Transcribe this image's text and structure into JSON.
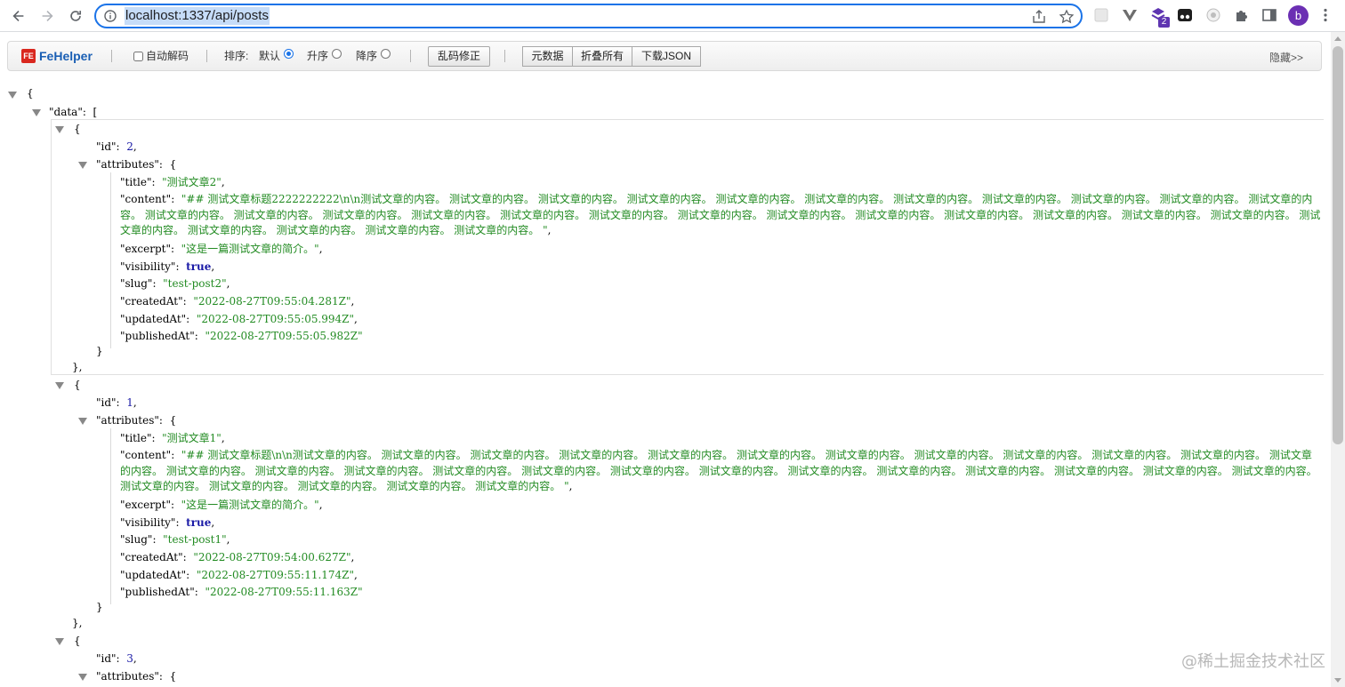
{
  "browser": {
    "url": "localhost:1337/api/posts",
    "profile_initial": "b",
    "extension_badge": "2"
  },
  "fehelper": {
    "brand": "FeHelper",
    "logo_mark": "FE",
    "auto_decode_label": "自动解码",
    "sort_label": "排序:",
    "sort_default": "默认",
    "sort_asc": "升序",
    "sort_desc": "降序",
    "fix_garbled_button": "乱码修正",
    "raw_button": "元数据",
    "collapse_all_button": "折叠所有",
    "download_button": "下载JSON",
    "hide_label": "隐藏>>"
  },
  "json": {
    "open_brace": "{",
    "data_key": "\"data\":",
    "open_bracket": "[",
    "posts": [
      {
        "id_key": "\"id\":",
        "id": "2",
        "attributes_key": "\"attributes\":",
        "title_key": "\"title\":",
        "title": "\"测试文章2\"",
        "content_key": "\"content\":",
        "content": "\"## 测试文章标题2222222222\\n\\n测试文章的内容。 测试文章的内容。 测试文章的内容。 测试文章的内容。 测试文章的内容。 测试文章的内容。 测试文章的内容。 测试文章的内容。 测试文章的内容。 测试文章的内容。 测试文章的内容。 测试文章的内容。 测试文章的内容。 测试文章的内容。 测试文章的内容。 测试文章的内容。 测试文章的内容。 测试文章的内容。 测试文章的内容。 测试文章的内容。 测试文章的内容。 测试文章的内容。 测试文章的内容。 测试文章的内容。 测试文章的内容。 测试文章的内容。 测试文章的内容。 测试文章的内容。 测试文章的内容。 \"",
        "excerpt_key": "\"excerpt\":",
        "excerpt": "\"这是一篇测试文章的简介。\"",
        "visibility_key": "\"visibility\":",
        "visibility": "true",
        "slug_key": "\"slug\":",
        "slug": "\"test-post2\"",
        "createdAt_key": "\"createdAt\":",
        "createdAt": "\"2022-08-27T09:55:04.281Z\"",
        "updatedAt_key": "\"updatedAt\":",
        "updatedAt": "\"2022-08-27T09:55:05.994Z\"",
        "publishedAt_key": "\"publishedAt\":",
        "publishedAt": "\"2022-08-27T09:55:05.982Z\""
      },
      {
        "id_key": "\"id\":",
        "id": "1",
        "attributes_key": "\"attributes\":",
        "title_key": "\"title\":",
        "title": "\"测试文章1\"",
        "content_key": "\"content\":",
        "content": "\"## 测试文章标题\\n\\n测试文章的内容。 测试文章的内容。 测试文章的内容。 测试文章的内容。 测试文章的内容。 测试文章的内容。 测试文章的内容。 测试文章的内容。 测试文章的内容。 测试文章的内容。 测试文章的内容。 测试文章的内容。 测试文章的内容。 测试文章的内容。 测试文章的内容。 测试文章的内容。 测试文章的内容。 测试文章的内容。 测试文章的内容。 测试文章的内容。 测试文章的内容。 测试文章的内容。 测试文章的内容。 测试文章的内容。 测试文章的内容。 测试文章的内容。 测试文章的内容。 测试文章的内容。 测试文章的内容。 测试文章的内容。 \"",
        "excerpt_key": "\"excerpt\":",
        "excerpt": "\"这是一篇测试文章的简介。\"",
        "visibility_key": "\"visibility\":",
        "visibility": "true",
        "slug_key": "\"slug\":",
        "slug": "\"test-post1\"",
        "createdAt_key": "\"createdAt\":",
        "createdAt": "\"2022-08-27T09:54:00.627Z\"",
        "updatedAt_key": "\"updatedAt\":",
        "updatedAt": "\"2022-08-27T09:55:11.174Z\"",
        "publishedAt_key": "\"publishedAt\":",
        "publishedAt": "\"2022-08-27T09:55:11.163Z\""
      },
      {
        "id_key": "\"id\":",
        "id": "3",
        "attributes_key": "\"attributes\":"
      }
    ]
  },
  "watermark": "@稀土掘金技术社区"
}
